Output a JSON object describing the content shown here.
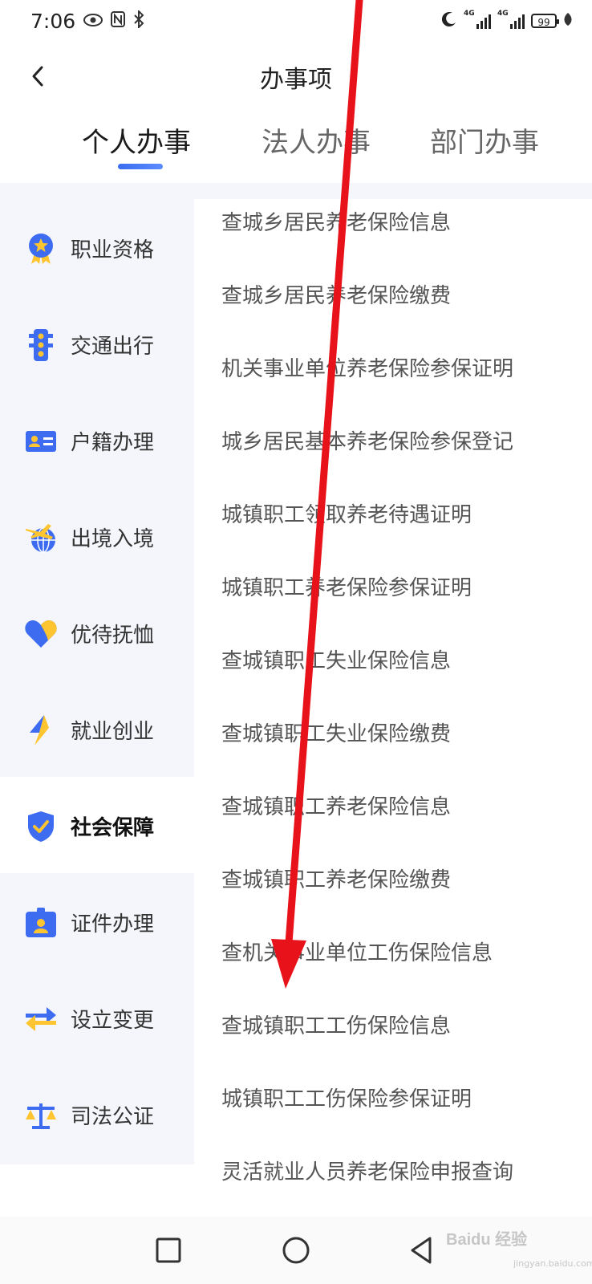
{
  "status": {
    "time": "7:06",
    "network_tag_1": "4G",
    "network_tag_2": "4G",
    "battery": "99"
  },
  "header": {
    "title": "办事项"
  },
  "tabs": [
    {
      "label": "个人办事",
      "active": true
    },
    {
      "label": "法人办事",
      "active": false
    },
    {
      "label": "部门办事",
      "active": false
    }
  ],
  "sidebar": {
    "items": [
      {
        "label": "职业资格",
        "icon": "medal-icon"
      },
      {
        "label": "交通出行",
        "icon": "traffic-light-icon"
      },
      {
        "label": "户籍办理",
        "icon": "id-card-icon"
      },
      {
        "label": "出境入境",
        "icon": "airplane-globe-icon"
      },
      {
        "label": "优待抚恤",
        "icon": "heart-icon"
      },
      {
        "label": "就业创业",
        "icon": "lightning-icon"
      },
      {
        "label": "社会保障",
        "icon": "shield-check-icon",
        "active": true
      },
      {
        "label": "证件办理",
        "icon": "badge-icon"
      },
      {
        "label": "设立变更",
        "icon": "swap-arrows-icon"
      },
      {
        "label": "司法公证",
        "icon": "scales-icon"
      }
    ]
  },
  "list": {
    "items": [
      "查城乡居民养老保险信息",
      "查城乡居民养老保险缴费",
      "机关事业单位养老保险参保证明",
      "城乡居民基本养老保险参保登记",
      "城镇职工领取养老待遇证明",
      "城镇职工养老保险参保证明",
      "查城镇职工失业保险信息",
      "查城镇职工失业保险缴费",
      "查城镇职工养老保险信息",
      "查城镇职工养老保险缴费",
      "查机关事业单位工伤保险信息",
      "查城镇职工工伤保险信息",
      "城镇职工工伤保险参保证明",
      "灵活就业人员养老保险申报查询"
    ]
  },
  "nav": {
    "recents_icon": "square-icon",
    "home_icon": "circle-icon",
    "back_icon": "triangle-back-icon"
  },
  "watermark": {
    "text": "Baidu 经验",
    "sub": "jingyan.baidu.com"
  },
  "colors": {
    "accent": "#3b6cf0",
    "icon_blue": "#3d6cf0",
    "icon_yellow": "#ffc530",
    "sidebar_bg": "#f4f6fb",
    "annotation_arrow": "#e8121a"
  }
}
